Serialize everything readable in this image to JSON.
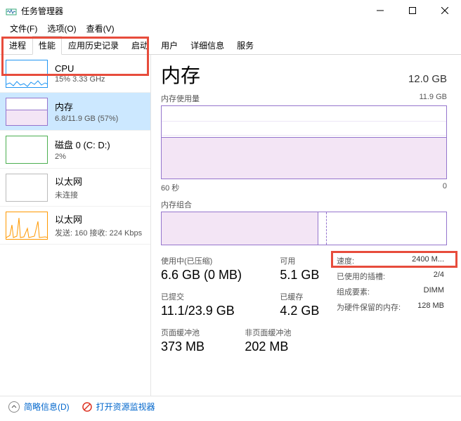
{
  "window": {
    "title": "任务管理器"
  },
  "menu": {
    "file": "文件(F)",
    "file_u": "F",
    "options": "选项(O)",
    "options_u": "O",
    "view": "查看(V)",
    "view_u": "V"
  },
  "tabs": [
    "进程",
    "性能",
    "应用历史记录",
    "启动",
    "用户",
    "详细信息",
    "服务"
  ],
  "active_tab": 1,
  "sidebar": {
    "items": [
      {
        "name": "CPU",
        "detail": "15% 3.33 GHz"
      },
      {
        "name": "内存",
        "detail": "6.8/11.9 GB (57%)"
      },
      {
        "name": "磁盘 0 (C: D:)",
        "detail": "2%"
      },
      {
        "name": "以太网",
        "detail": "未连接"
      },
      {
        "name": "以太网",
        "detail": "发送: 160 接收: 224 Kbps"
      }
    ]
  },
  "main": {
    "title": "内存",
    "total": "12.0 GB",
    "usage_label": "内存使用量",
    "usage_max": "11.9 GB",
    "axis_left": "60 秒",
    "axis_right": "0",
    "composition_label": "内存组合",
    "stats": {
      "in_use_label": "使用中(已压缩)",
      "in_use_value": "6.6 GB (0 MB)",
      "available_label": "可用",
      "available_value": "5.1 GB",
      "committed_label": "已提交",
      "committed_value": "11.1/23.9 GB",
      "cached_label": "已缓存",
      "cached_value": "4.2 GB",
      "paged_label": "页面缓冲池",
      "paged_value": "373 MB",
      "nonpaged_label": "非页面缓冲池",
      "nonpaged_value": "202 MB"
    },
    "specs": {
      "speed_k": "速度:",
      "speed_v": "2400 M...",
      "slots_k": "已使用的插槽:",
      "slots_v": "2/4",
      "form_k": "组成要素:",
      "form_v": "DIMM",
      "reserved_k": "为硬件保留的内存:",
      "reserved_v": "128 MB"
    }
  },
  "footer": {
    "fewer": "简略信息(D)",
    "resmon": "打开资源监视器"
  },
  "chart_data": {
    "type": "area",
    "title": "内存使用量",
    "ylabel": "GB",
    "ylim": [
      0,
      11.9
    ],
    "xlim_seconds": [
      60,
      0
    ],
    "current_used_gb": 6.8,
    "percent": 57,
    "composition": {
      "in_use_gb": 6.6,
      "cached_gb": 4.2,
      "available_gb": 5.1,
      "total_gb": 11.9
    }
  }
}
